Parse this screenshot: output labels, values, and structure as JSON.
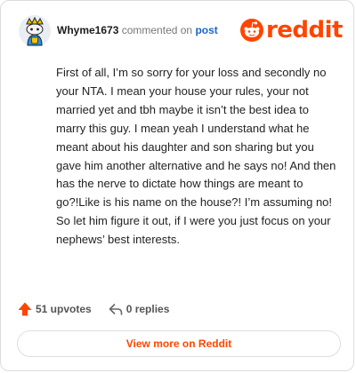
{
  "comment": {
    "username": "Whyme1673",
    "action_text": "commented on",
    "post_link_label": "post",
    "body": "First of all, I’m so sorry for your loss and secondly no your NTA. I mean your house your rules, your not married yet and tbh maybe it isn’t the best idea to marry this guy. I mean yeah I understand what he meant about his daughter and son sharing but you gave him another alternative and he says no! And then has the nerve to dictate how things are meant to go?!Like is his name on the house?! I’m assuming no! So let him figure it out, if I were you just focus on your nephews’ best interests."
  },
  "brand": {
    "wordmark": "reddit",
    "color": "#ff4500"
  },
  "stats": {
    "upvotes_label": "51 upvotes",
    "replies_label": "0 replies"
  },
  "actions": {
    "view_more_label": "View more on Reddit"
  },
  "icons": {
    "avatar": "avatar-icon",
    "upvote": "upvote-arrow-icon",
    "reply": "reply-arrow-icon",
    "brand": "reddit-snoo-icon"
  }
}
